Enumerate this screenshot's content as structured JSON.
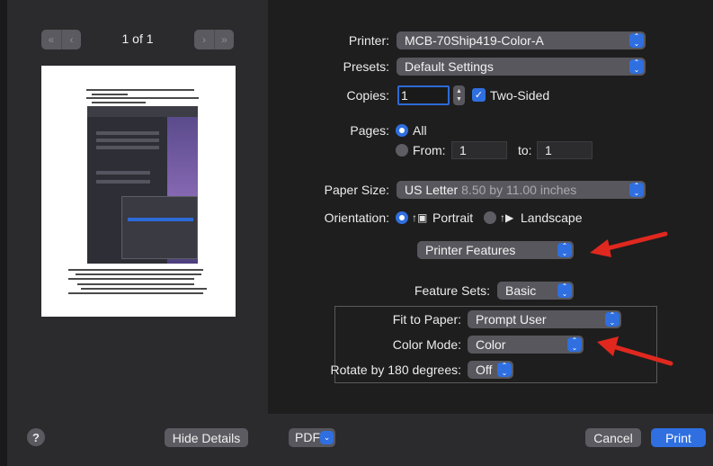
{
  "preview": {
    "page_indicator": "1 of 1",
    "prev_glyph_first": "«",
    "prev_glyph": "‹",
    "next_glyph": "›",
    "next_glyph_last": "»"
  },
  "settings": {
    "printer_label": "Printer:",
    "printer_value": "MCB-70Ship419-Color-A",
    "presets_label": "Presets:",
    "presets_value": "Default Settings",
    "copies_label": "Copies:",
    "copies_value": "1",
    "two_sided_label": "Two-Sided",
    "two_sided_checked": true,
    "pages_label": "Pages:",
    "pages_all_label": "All",
    "pages_from_label": "From:",
    "pages_from_value": "1",
    "pages_to_label": "to:",
    "pages_to_value": "1",
    "paper_size_label": "Paper Size:",
    "paper_size_value": "US Letter",
    "paper_size_detail": "8.50 by 11.00 inches",
    "orientation_label": "Orientation:",
    "orientation_portrait": "Portrait",
    "orientation_landscape": "Landscape",
    "section_popup_value": "Printer Features",
    "feature_sets_label": "Feature Sets:",
    "feature_sets_value": "Basic",
    "fit_to_paper_label": "Fit to Paper:",
    "fit_to_paper_value": "Prompt User",
    "color_mode_label": "Color Mode:",
    "color_mode_value": "Color",
    "rotate_label": "Rotate by 180 degrees:",
    "rotate_value": "Off"
  },
  "footer": {
    "help_label": "?",
    "hide_details_label": "Hide Details",
    "pdf_label": "PDF",
    "cancel_label": "Cancel",
    "print_label": "Print"
  },
  "colors": {
    "accent": "#2f6fe0",
    "annotation_arrow": "#e0281f",
    "popup_bg": "#58575d",
    "pane_bg": "#1e1e1e",
    "sidebar_bg": "#2b2a2d"
  },
  "icons": {
    "popup_chevron": "chevron-updown-icon",
    "help": "question-icon",
    "portrait": "portrait-orientation-icon",
    "landscape": "landscape-orientation-icon",
    "annotation": "red-arrow-icon"
  }
}
